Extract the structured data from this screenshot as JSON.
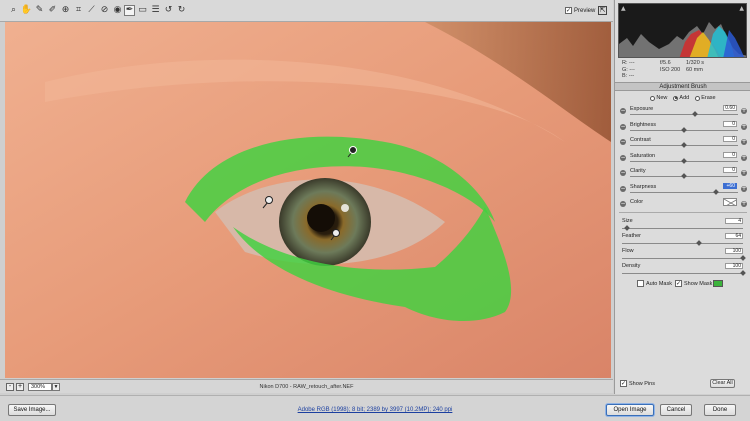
{
  "toolbar": {
    "tools": [
      {
        "icon": "zoom-icon",
        "glyph": "⌕"
      },
      {
        "icon": "hand-icon",
        "glyph": "✋"
      },
      {
        "icon": "white-balance-icon",
        "glyph": "✎"
      },
      {
        "icon": "color-sampler-icon",
        "glyph": "✐"
      },
      {
        "icon": "targeted-adjustment-icon",
        "glyph": "⊕"
      },
      {
        "icon": "crop-icon",
        "glyph": "⌗"
      },
      {
        "icon": "straighten-icon",
        "glyph": "⟋"
      },
      {
        "icon": "spot-removal-icon",
        "glyph": "⊘"
      },
      {
        "icon": "red-eye-icon",
        "glyph": "◉"
      },
      {
        "icon": "adjustment-brush-icon",
        "glyph": "✒"
      },
      {
        "icon": "graduated-filter-icon",
        "glyph": "▭"
      },
      {
        "icon": "preferences-icon",
        "glyph": "☰"
      },
      {
        "icon": "rotate-ccw-icon",
        "glyph": "↺"
      },
      {
        "icon": "rotate-cw-icon",
        "glyph": "↻"
      }
    ],
    "preview_label": "Preview",
    "preview_checked": "✓"
  },
  "status": {
    "zoom_minus": "-",
    "zoom_plus": "+",
    "zoom_value": "300%",
    "filename": "Nikon D700 - RAW_retouch_after.NEF"
  },
  "histogram": {
    "clip_left": "▲",
    "clip_right": "▲",
    "r_label": "R:",
    "r_value": "---",
    "g_label": "G:",
    "g_value": "---",
    "b_label": "B:",
    "b_value": "---",
    "aperture": "f/5.6",
    "shutter": "1/320 s",
    "iso": "ISO 200",
    "focal": "60 mm"
  },
  "panel": {
    "title": "Adjustment Brush",
    "modes": [
      {
        "label": "New",
        "selected": false
      },
      {
        "label": "Add",
        "selected": true
      },
      {
        "label": "Erase",
        "selected": false
      }
    ],
    "adjustments": [
      {
        "label": "Exposure",
        "value": "0.60",
        "pos": 0.6
      },
      {
        "label": "Brightness",
        "value": "0",
        "pos": 0.5
      },
      {
        "label": "Contrast",
        "value": "0",
        "pos": 0.5
      },
      {
        "label": "Saturation",
        "value": "0",
        "pos": 0.5
      },
      {
        "label": "Clarity",
        "value": "0",
        "pos": 0.5
      },
      {
        "label": "Sharpness",
        "value": "+60",
        "pos": 0.8
      }
    ],
    "color_label": "Color",
    "brush": [
      {
        "label": "Size",
        "value": "4",
        "pos": 0.04
      },
      {
        "label": "Feather",
        "value": "64",
        "pos": 0.64
      },
      {
        "label": "Flow",
        "value": "100",
        "pos": 1.0
      },
      {
        "label": "Density",
        "value": "100",
        "pos": 1.0
      }
    ],
    "auto_mask_label": "Auto Mask",
    "show_mask_label": "Show Mask",
    "show_mask_checked": "✓",
    "mask_color": "#3bb33b",
    "show_pins_label": "Show Pins",
    "show_pins_checked": "✓",
    "clear_all_label": "Clear All"
  },
  "bottom": {
    "save_label": "Save Image...",
    "workflow": "Adobe RGB (1998); 8 bit; 2389 by 3997 (10.2MP); 240 ppi",
    "open_label": "Open Image",
    "cancel_label": "Cancel",
    "done_label": "Done"
  }
}
